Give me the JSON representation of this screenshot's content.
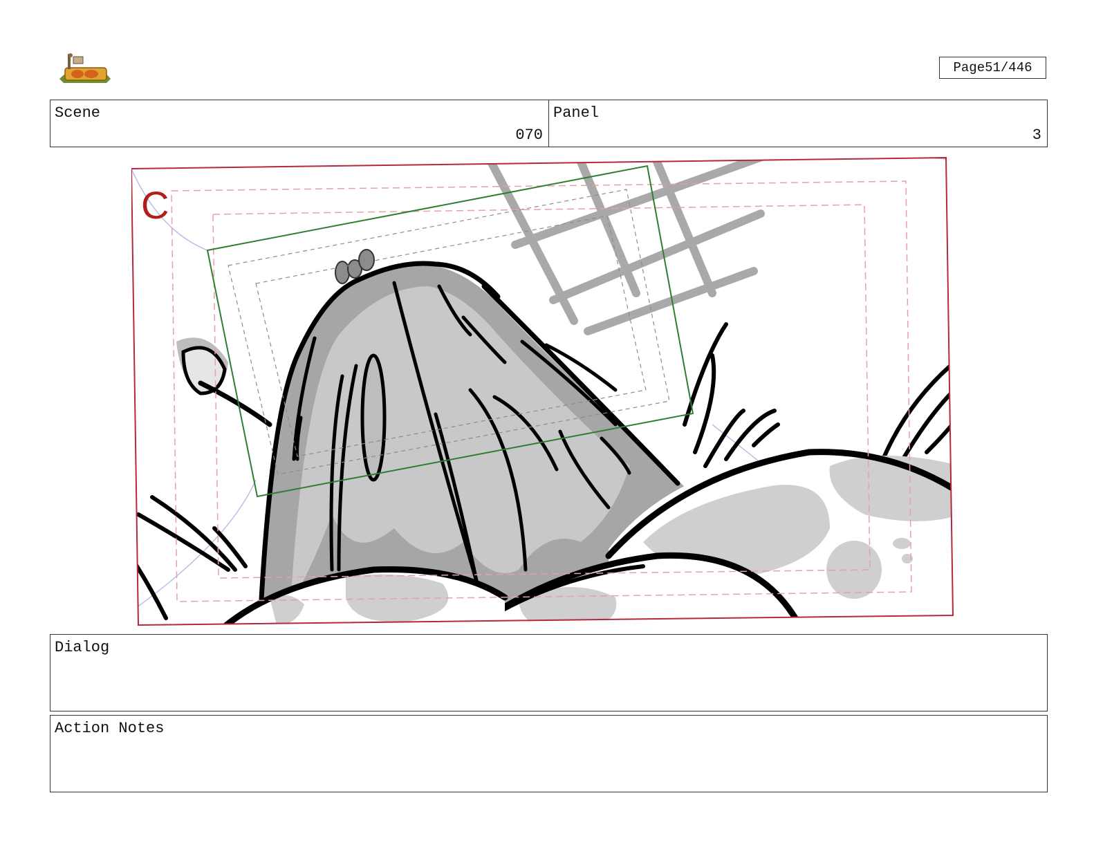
{
  "header": {
    "page_label": "Page",
    "page_value": "51/446"
  },
  "scene": {
    "label": "Scene",
    "value": "070"
  },
  "panel": {
    "label": "Panel",
    "value": "3"
  },
  "frame": {
    "camera_marker": "C"
  },
  "dialog": {
    "label": "Dialog"
  },
  "action_notes": {
    "label": "Action Notes"
  },
  "colors": {
    "frame_red": "#b5273a",
    "camera_green": "#2f7d2f",
    "safe_pink": "#e8a0a8",
    "guide_blue": "#b9bde6"
  }
}
